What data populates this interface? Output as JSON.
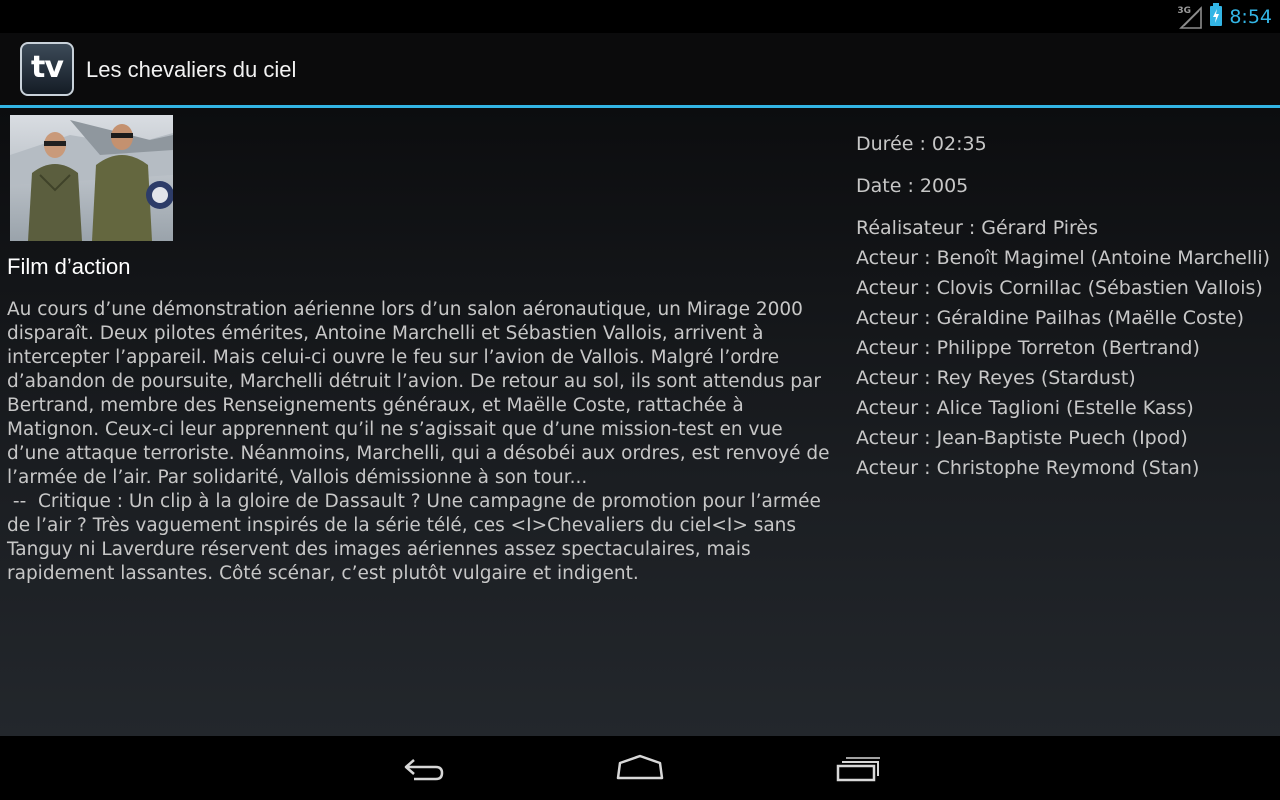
{
  "status_bar": {
    "network_type": "3G",
    "signal_icon": "signal-icon",
    "battery_icon": "battery-charging-icon",
    "time": "8:54",
    "accent_color": "#33b5e5"
  },
  "action_bar": {
    "logo_text": "tv",
    "title": "Les chevaliers du ciel"
  },
  "program": {
    "poster_icon": "movie-poster-image",
    "genre": "Film d’action",
    "synopsis": "Au cours d’une démonstration aérienne lors d’un salon aéronautique, un Mirage 2000\ndisparaît. Deux pilotes émérites, Antoine Marchelli et Sébastien Vallois, arrivent à\nintercepter l’appareil. Mais celui-ci ouvre le feu sur l’avion de Vallois. Malgré l’ordre\nd’abandon de poursuite, Marchelli détruit l’avion. De retour au sol, ils sont attendus par\nBertrand, membre des Renseignements généraux, et Maëlle Coste, rattachée à\nMatignon. Ceux-ci leur apprennent qu’il ne s’agissait que d’une mission-test en vue\nd’une attaque terroriste. Néanmoins, Marchelli, qui a désobéi aux ordres, est renvoyé de\nl’armée de l’air. Par solidarité, Vallois démissionne à son tour...\n --  Critique : Un clip à la gloire de Dassault ? Une campagne de promotion pour l’armée\nde l’air ? Très vaguement inspirés de la série télé, ces <I>Chevaliers du ciel<I> sans\nTanguy ni Laverdure réservent des images aériennes assez spectaculaires, mais\nrapidement lassantes. Côté scénar, c’est plutôt vulgaire et indigent.",
    "duration": "Durée : 02:35",
    "date": "Date : 2005",
    "credits": [
      "Réalisateur : Gérard Pirès",
      "Acteur : Benoît Magimel (Antoine Marchelli)",
      "Acteur : Clovis Cornillac (Sébastien Vallois)",
      "Acteur : Géraldine Pailhas (Maëlle Coste)",
      "Acteur : Philippe Torreton (Bertrand)",
      "Acteur : Rey Reyes (Stardust)",
      "Acteur : Alice Taglioni (Estelle Kass)",
      "Acteur : Jean-Baptiste Puech (Ipod)",
      "Acteur : Christophe Reymond (Stan)"
    ]
  },
  "nav_bar": {
    "back_icon": "back-icon",
    "home_icon": "home-icon",
    "recents_icon": "recent-apps-icon"
  }
}
